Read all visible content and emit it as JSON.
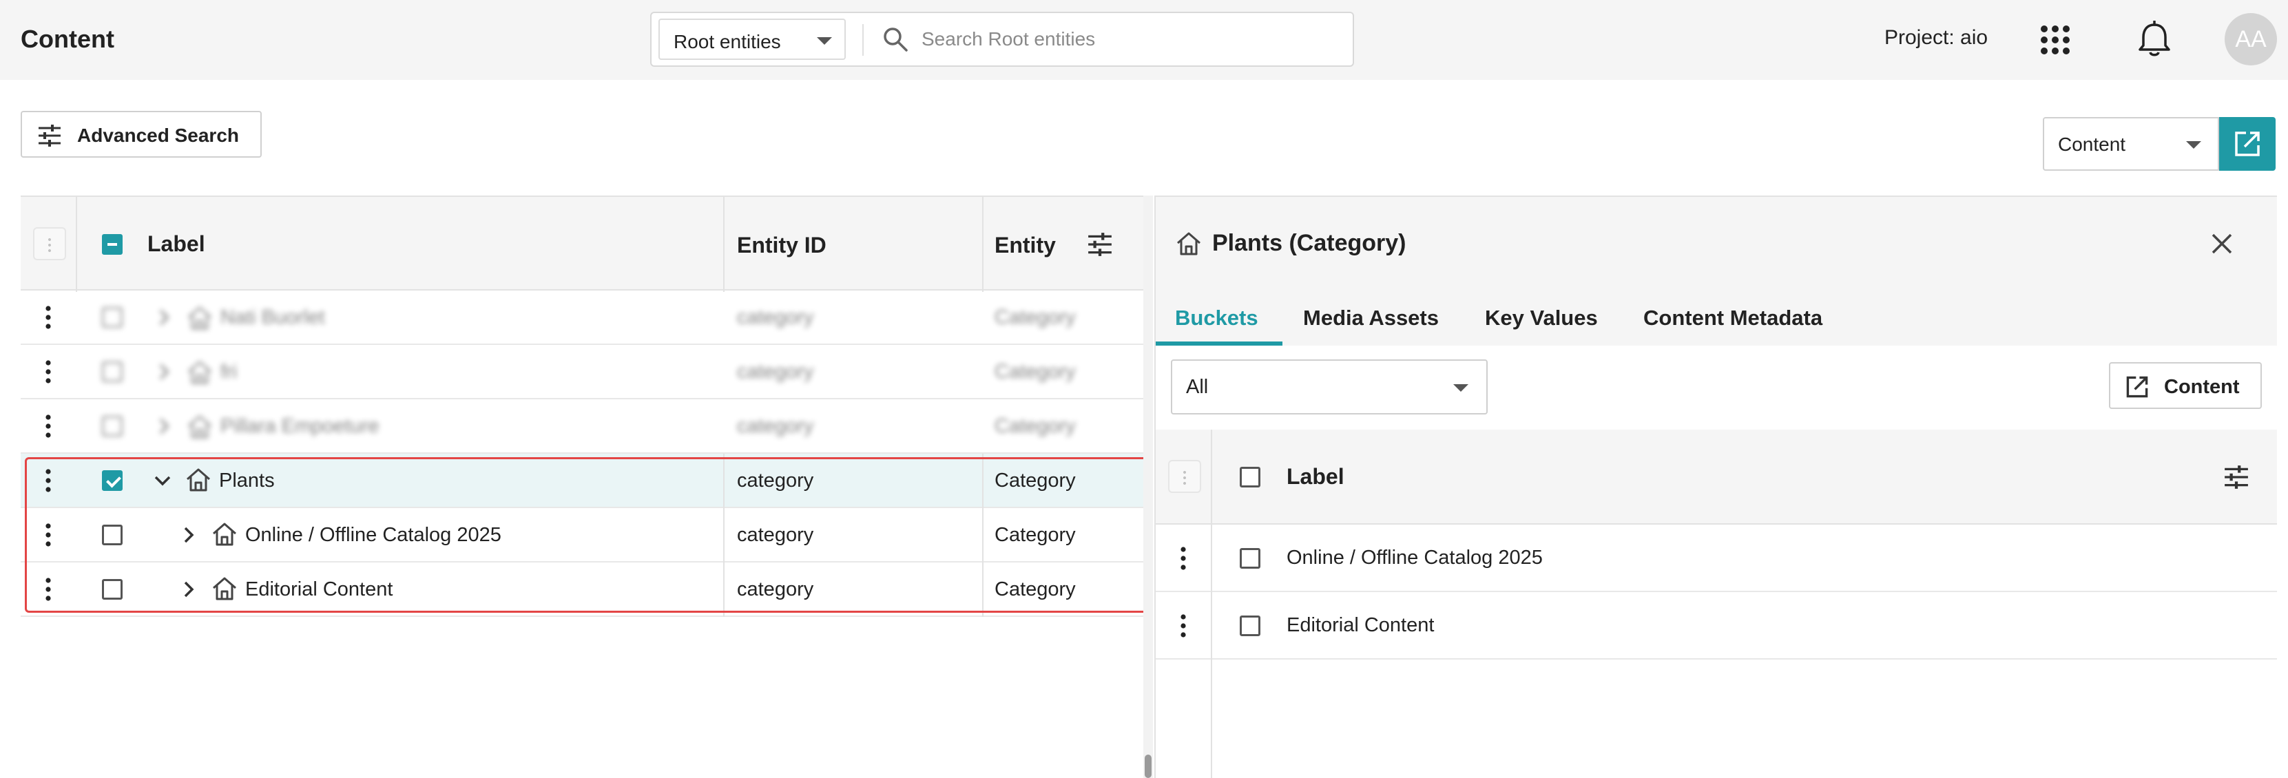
{
  "app": {
    "title": "Content"
  },
  "search": {
    "scope": "Root entities",
    "placeholder": "Search Root entities",
    "value": ""
  },
  "header": {
    "project_label": "Project: aio",
    "avatar_initials": "AA"
  },
  "toolbar": {
    "advanced_search_label": "Advanced Search",
    "content_select": "Content"
  },
  "colors": {
    "accent": "#1f9aa5",
    "highlight_border": "#e34545",
    "header_bg": "#f5f5f5"
  },
  "left_table": {
    "columns": {
      "label": "Label",
      "entity_id": "Entity ID",
      "entity": "Entity"
    },
    "rows": [
      {
        "label": "Nati Buorlet",
        "entity_id": "category",
        "entity": "Category",
        "blurred": true
      },
      {
        "label": "fri",
        "entity_id": "category",
        "entity": "Category",
        "blurred": true
      },
      {
        "label": "Pillara Empoeture",
        "entity_id": "category",
        "entity": "Category",
        "blurred": true
      },
      {
        "label": "Plants",
        "entity_id": "category",
        "entity": "Category",
        "checked": true,
        "expanded": true
      },
      {
        "label": "Online / Offline Catalog 2025",
        "entity_id": "category",
        "entity": "Category",
        "checked": false,
        "expanded": false
      },
      {
        "label": "Editorial Content",
        "entity_id": "category",
        "entity": "Category",
        "checked": false,
        "expanded": false
      }
    ]
  },
  "detail_panel": {
    "title": "Plants (Category)",
    "tabs": [
      "Buckets",
      "Media Assets",
      "Key Values",
      "Content Metadata"
    ],
    "active_tab": "Buckets",
    "filter": "All",
    "content_button": "Content",
    "table": {
      "label_header": "Label",
      "rows": [
        "Online / Offline Catalog 2025",
        "Editorial Content"
      ]
    }
  }
}
